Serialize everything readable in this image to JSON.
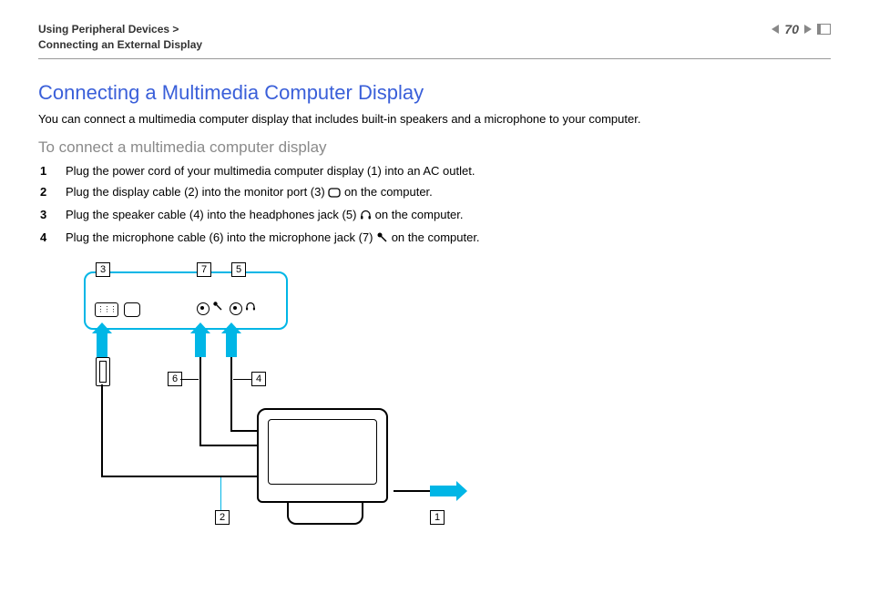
{
  "header": {
    "breadcrumb_line1": "Using Peripheral Devices >",
    "breadcrumb_line2": "Connecting an External Display",
    "page_number": "70"
  },
  "title": "Connecting a Multimedia Computer Display",
  "intro": "You can connect a multimedia computer display that includes built-in speakers and a microphone to your computer.",
  "subhead": "To connect a multimedia computer display",
  "steps": [
    {
      "text_before": "Plug the power cord of your multimedia computer display (1) into an AC outlet.",
      "icon": null,
      "text_after": ""
    },
    {
      "text_before": "Plug the display cable (2) into the monitor port (3) ",
      "icon": "monitor-port",
      "text_after": " on the computer."
    },
    {
      "text_before": "Plug the speaker cable (4) into the headphones jack (5) ",
      "icon": "headphones",
      "text_after": " on the computer."
    },
    {
      "text_before": "Plug the microphone cable (6) into the microphone jack (7) ",
      "icon": "microphone",
      "text_after": " on the computer."
    }
  ],
  "diagram": {
    "callouts": {
      "c1": "1",
      "c2": "2",
      "c3": "3",
      "c4": "4",
      "c5": "5",
      "c6": "6",
      "c7": "7"
    }
  }
}
